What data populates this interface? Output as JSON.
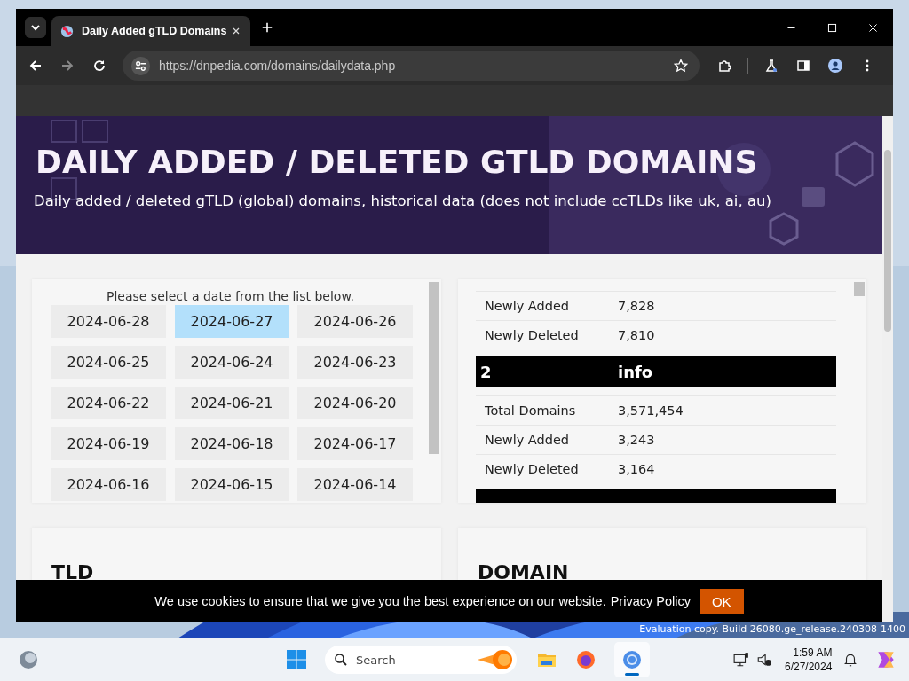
{
  "browser": {
    "tab": {
      "title": "Daily Added gTLD Domains"
    },
    "url": "https://dnpedia.com/domains/dailydata.php"
  },
  "page": {
    "banner": {
      "title": "DAILY ADDED / DELETED GTLD DOMAINS",
      "subtitle": "Daily added / deleted gTLD (global) domains, historical data (does not include ccTLDs like uk, ai, au)"
    },
    "date_picker": {
      "prompt": "Please select a date from the list below.",
      "dates": [
        {
          "label": "2024-06-28",
          "selected": false
        },
        {
          "label": "2024-06-27",
          "selected": true
        },
        {
          "label": "2024-06-26",
          "selected": false
        },
        {
          "label": "2024-06-25",
          "selected": false
        },
        {
          "label": "2024-06-24",
          "selected": false
        },
        {
          "label": "2024-06-23",
          "selected": false
        },
        {
          "label": "2024-06-22",
          "selected": false
        },
        {
          "label": "2024-06-21",
          "selected": false
        },
        {
          "label": "2024-06-20",
          "selected": false
        },
        {
          "label": "2024-06-19",
          "selected": false
        },
        {
          "label": "2024-06-18",
          "selected": false
        },
        {
          "label": "2024-06-17",
          "selected": false
        },
        {
          "label": "2024-06-16",
          "selected": false
        },
        {
          "label": "2024-06-15",
          "selected": false
        },
        {
          "label": "2024-06-14",
          "selected": false
        }
      ]
    },
    "stats": {
      "rows": [
        {
          "kind": "stat",
          "label": "Newly Added",
          "value": "7,828"
        },
        {
          "kind": "stat",
          "label": "Newly Deleted",
          "value": "7,810"
        },
        {
          "kind": "header",
          "number": "2",
          "name": "info"
        },
        {
          "kind": "stat",
          "label": "Total Domains",
          "value": "3,571,454"
        },
        {
          "kind": "stat",
          "label": "Newly Added",
          "value": "3,243"
        },
        {
          "kind": "stat",
          "label": "Newly Deleted",
          "value": "3,164"
        },
        {
          "kind": "header"
        }
      ]
    },
    "sections": [
      {
        "heading": "TLD"
      },
      {
        "heading": "DOMAIN"
      }
    ]
  },
  "cookie_bar": {
    "message": "We use cookies to ensure that we give you the best experience on our website.",
    "link": "Privacy Policy",
    "button": "OK"
  },
  "desktop": {
    "watermark": "Evaluation copy. Build 26080.ge_release.240308-1400"
  },
  "taskbar": {
    "search": "Search",
    "time": "1:59 AM",
    "date": "6/27/2024"
  }
}
